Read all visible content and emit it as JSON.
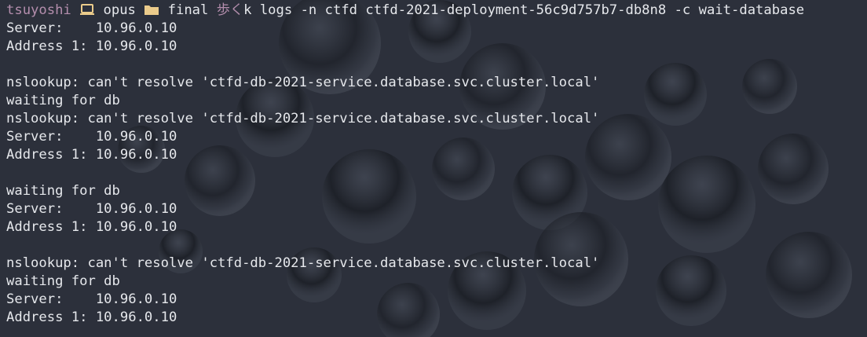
{
  "prompt": {
    "user": "tsuyoshi",
    "laptop_icon": "laptop-icon",
    "host": "opus",
    "folder_icon": "folder-icon",
    "directory": "final",
    "symbol": "歩く",
    "command": "k logs -n ctfd ctfd-2021-deployment-56c9d757b7-db8n8 -c wait-database"
  },
  "colors": {
    "user": "#b48ead",
    "icon": "#ebcb8b",
    "text": "#e6e8ec",
    "background": "#2c303b"
  },
  "output": [
    "Server:    10.96.0.10",
    "Address 1: 10.96.0.10",
    "",
    "nslookup: can't resolve 'ctfd-db-2021-service.database.svc.cluster.local'",
    "waiting for db",
    "nslookup: can't resolve 'ctfd-db-2021-service.database.svc.cluster.local'",
    "Server:    10.96.0.10",
    "Address 1: 10.96.0.10",
    "",
    "waiting for db",
    "Server:    10.96.0.10",
    "Address 1: 10.96.0.10",
    "",
    "nslookup: can't resolve 'ctfd-db-2021-service.database.svc.cluster.local'",
    "waiting for db",
    "Server:    10.96.0.10",
    "Address 1: 10.96.0.10"
  ]
}
